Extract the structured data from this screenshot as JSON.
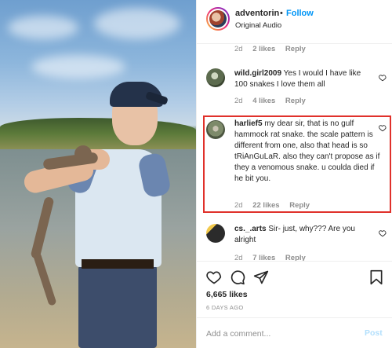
{
  "post": {
    "username": "adventorin",
    "separator": "•",
    "follow_label": "Follow",
    "audio_label": "Original Audio"
  },
  "comments": [
    {
      "meta": {
        "time": "2d",
        "likes": "2 likes",
        "reply": "Reply"
      }
    },
    {
      "author": "wild.girl2009",
      "text": " Yes I would I have like 100 snakes I love them all",
      "meta": {
        "time": "2d",
        "likes": "4 likes",
        "reply": "Reply"
      },
      "avatar_color": "#5c6b4e"
    },
    {
      "author": "harlief5",
      "text": " my dear sir, that is no gulf hammock rat snake. the scale pattern is different from one, also that head is so tRiAnGuLaR. also they can't propose as if they a venomous snake. u coulda died if he bit you.",
      "meta": {
        "time": "2d",
        "likes": "22 likes",
        "reply": "Reply"
      },
      "avatar_color": "#7d8a6a",
      "highlighted": true
    },
    {
      "author": "cs._.arts",
      "text": " Sir- just, why??? Are you alright",
      "meta": {
        "time": "2d",
        "likes": "7 likes",
        "reply": "Reply"
      },
      "avatar_color": "#2b2b2b"
    }
  ],
  "actions": {
    "icons": [
      "heart-icon",
      "comment-icon",
      "share-icon",
      "bookmark-icon"
    ],
    "likes_count": "6,665 likes",
    "posted_ago": "6 DAYS AGO"
  },
  "add_comment": {
    "placeholder": "Add a comment...",
    "post_label": "Post"
  },
  "colors": {
    "accent": "#0095f6",
    "highlight_border": "#e0312b",
    "post_disabled": "#b2dffc"
  }
}
